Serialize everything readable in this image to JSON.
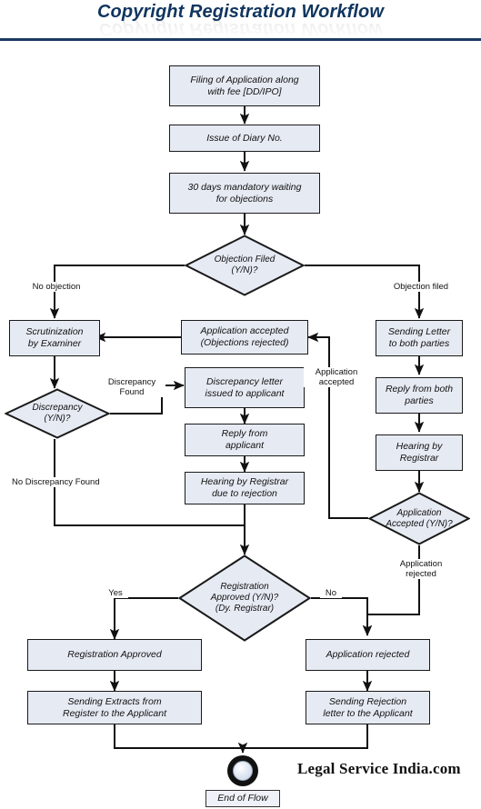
{
  "header": {
    "title": "Copyright Registration Workflow",
    "reflection": "Copyright Registration Workflow",
    "title_color": "#10355f",
    "rule_color": "#1b3a63"
  },
  "theme": {
    "node_fill": "#e6eaf3",
    "node_border": "#1a1a1a",
    "edge_color": "#111111",
    "page_background": "#ffffff"
  },
  "nodes": {
    "filing": "Filing of Application along\nwith fee [DD/IPO]",
    "diary": "Issue of Diary No.",
    "waiting": "30 days mandatory waiting\nfor objections",
    "objection_filed_q": "Objection Filed\n(Y/N)?",
    "scrutinization": "Scrutinization\nby Examiner",
    "application_accepted": "Application accepted\n(Objections rejected)",
    "sending_letter": "Sending Letter\nto both parties",
    "discrepancy_q": "Discrepancy\n(Y/N)?",
    "discrepancy_letter": "Discrepancy letter\nissued to applicant",
    "reply_from_both": "Reply from both\nparties",
    "reply_from_applicant": "Reply from\napplicant",
    "hearing_registrar": "Hearing by\nRegistrar",
    "hearing_rejection": "Hearing by Registrar\ndue to rejection",
    "application_accepted_q": "Application\nAccepted (Y/N)?",
    "registration_approved_q": "Registration\nApproved (Y/N)?\n(Dy. Registrar)",
    "registration_approved": "Registration Approved",
    "application_rejected": "Application rejected",
    "sending_extracts": "Sending Extracts from\nRegister to the Applicant",
    "sending_rejection": "Sending Rejection\nletter to the Applicant",
    "end_of_flow": "End of Flow"
  },
  "edge_labels": {
    "no_objection": "No objection",
    "objection_filed": "Objection filed",
    "discrepancy_found": "Discrepancy\nFound",
    "no_discrepancy_found": "No Discrepancy Found",
    "application_accepted_branch": "Application\naccepted",
    "application_rejected_branch": "Application\nrejected",
    "yes": "Yes",
    "no": "No"
  },
  "footer": {
    "watermark": "Legal Service India.com"
  }
}
